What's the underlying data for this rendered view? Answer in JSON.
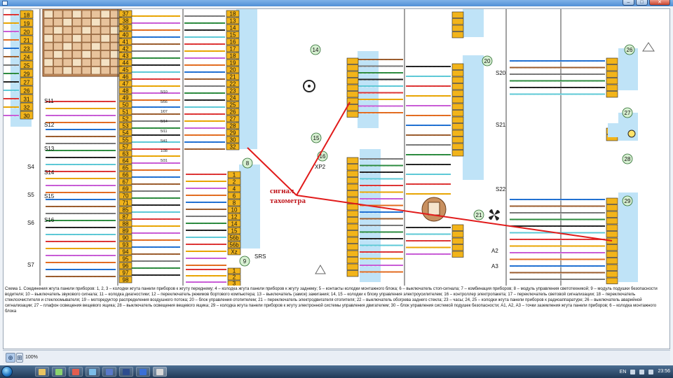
{
  "window": {
    "title": ""
  },
  "diagram": {
    "annotation_line1": "сигнал",
    "annotation_line2": "тахометра",
    "connector_xp2": "XP2",
    "connector_srs": "SRS",
    "colors": {
      "pin": "#f2b41a",
      "highlight": "#e11b1b",
      "panel": "#bfe3f7",
      "block": "#c89060"
    },
    "harness_left_pins": [
      "18",
      "19",
      "20",
      "21",
      "23",
      "24",
      "25",
      "29",
      "27",
      "26",
      "31",
      "32",
      "30"
    ],
    "harness_mid_pins": [
      "37",
      "38",
      "39",
      "40",
      "41",
      "42",
      "43",
      "44",
      "45",
      "46",
      "47",
      "48",
      "49",
      "50",
      "51",
      "52",
      "53",
      "54",
      "55",
      "57",
      "63",
      "64",
      "65",
      "66",
      "67",
      "69",
      "70",
      "71",
      "85",
      "87",
      "88",
      "89",
      "90",
      "93",
      "94",
      "95",
      "96",
      "97",
      "98"
    ],
    "conn_a_pins": [
      "18",
      "13",
      "14",
      "15",
      "16",
      "17",
      "18",
      "19",
      "20",
      "21",
      "22",
      "23",
      "24",
      "25",
      "26",
      "27",
      "28",
      "29",
      "30",
      "32"
    ],
    "conn_8_pins": [
      "1",
      "2",
      "4",
      "6",
      "8",
      "10",
      "12",
      "14",
      "15",
      "56b",
      "56b",
      "Xz"
    ],
    "conn_9_pins": [
      "1",
      "2",
      "3"
    ],
    "s_labels": [
      "S11",
      "S12",
      "S13",
      "S14",
      "S15",
      "S16",
      "S4",
      "S5",
      "S6",
      "S7"
    ],
    "right_s_labels": [
      "S20",
      "S21",
      "S22",
      "A2",
      "A3"
    ],
    "component_numbers": [
      "8",
      "9",
      "14",
      "15",
      "16",
      "20",
      "21",
      "26",
      "27",
      "28",
      "29"
    ],
    "wire_label_sample": [
      "5/10",
      "5/56",
      "1/07",
      "5/14",
      "5/11",
      "5/41",
      "1/38",
      "5/31"
    ]
  },
  "caption": "Схема 1. Соединения жгута панели приборов: 1, 2, 3 – колодки жгута панели приборов к жгуту переднему; 4 – колодка жгута панели приборов к жгуту заднему; 5 – контакты колодки монтажного блока; 6 – выключатель стоп-сигнала; 7 – комбинация приборов; 8 – модуль управления светотехникой; 9 – модуль подушки безопасности водителя; 10 – выключатель звукового сигнала; 11 – колодка диагностики; 12 – переключатель режимов бортового компьютера; 13 – выключатель (замок) зажигания; 14, 15 – колодки к блоку управления электроусилителем; 16 – контроллер электропакета; 17 – переключатель световой сигнализации; 18 – переключатель стеклоочистителя и стеклоомывателя; 19 – моторедуктор распределения воздушного потока; 20 – блок управления отопителем; 21 – переключатель электродвигателя отопителя; 22 – выключатель обогрева заднего стекла; 23 – часы; 24, 25 – колодки жгута панели приборов к радиоаппаратуре; 26 – выключатель аварийной сигнализации; 27 – плафон освещения вещевого ящика; 28 – выключатель освещения вещевого ящика; 29 – колодка жгута панели приборов к жгуту электронной системы управления двигателем; 30 – блок управления системой подушек безопасности; А1, А2, А3 – точки заземления жгута панели приборов; 6 – колодка монтажного блока",
  "statusbar": {
    "zoom": "100%"
  },
  "taskbar": {
    "lang": "EN",
    "time": "23:56"
  }
}
